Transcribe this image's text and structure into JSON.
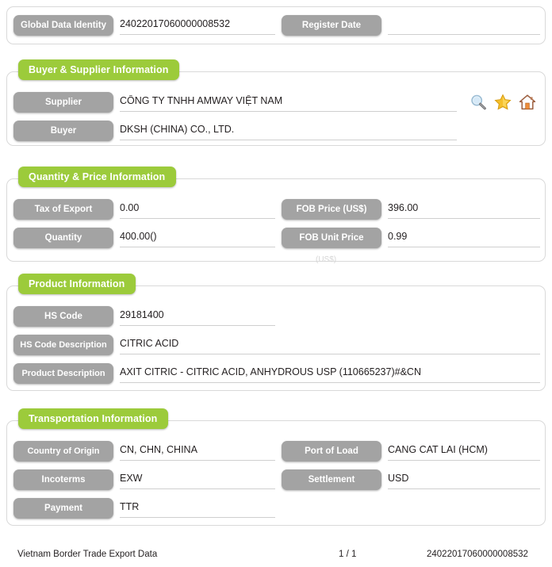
{
  "top_panel": {
    "fields": [
      {
        "label": "Global Data Identity",
        "value": "24022017060000008532"
      },
      {
        "label": "Register Date",
        "value": ""
      }
    ]
  },
  "buyer_supplier": {
    "title": "Buyer & Supplier Information",
    "fields": [
      {
        "label": "Supplier",
        "value": "CÔNG TY TNHH AMWAY VIỆT NAM"
      },
      {
        "label": "Buyer",
        "value": "DKSH (CHINA) CO., LTD."
      }
    ],
    "icons": [
      {
        "name": "search-icon",
        "title": "Search"
      },
      {
        "name": "star-icon",
        "title": "Favorite"
      },
      {
        "name": "home-icon",
        "title": "Home"
      }
    ]
  },
  "quantity_price": {
    "title": "Quantity & Price Information",
    "fields": [
      {
        "label": "Tax of Export",
        "value": "0.00"
      },
      {
        "label": "FOB Price (US$)",
        "value": "396.00"
      },
      {
        "label": "Quantity",
        "value": "400.00()"
      },
      {
        "label": "FOB Unit Price",
        "value": "0.99"
      }
    ],
    "ghost_note": "(US$)"
  },
  "product": {
    "title": "Product Information",
    "fields": [
      {
        "label": "HS Code",
        "value": "29181400"
      },
      {
        "label": "HS Code Description",
        "value": "CITRIC ACID"
      },
      {
        "label": "Product Description",
        "value": "AXIT CITRIC - CITRIC ACID, ANHYDROUS USP (110665237)#&CN"
      }
    ]
  },
  "transportation": {
    "title": "Transportation Information",
    "fields": [
      {
        "label": "Country of Origin",
        "value": "CN, CHN, CHINA"
      },
      {
        "label": "Port of Load",
        "value": "CANG CAT LAI (HCM)"
      },
      {
        "label": "Incoterms",
        "value": "EXW"
      },
      {
        "label": "Settlement",
        "value": "USD"
      },
      {
        "label": "Payment",
        "value": "TTR"
      }
    ]
  },
  "footer": {
    "source": "Vietnam Border Trade Export Data",
    "page": "1 / 1",
    "identity": "24022017060000008532"
  },
  "colors": {
    "tab_green": "#9ccb3b",
    "label_gray": "#a3a3a3",
    "panel_border": "#d9d9d9",
    "underline": "#cfcfcf"
  }
}
